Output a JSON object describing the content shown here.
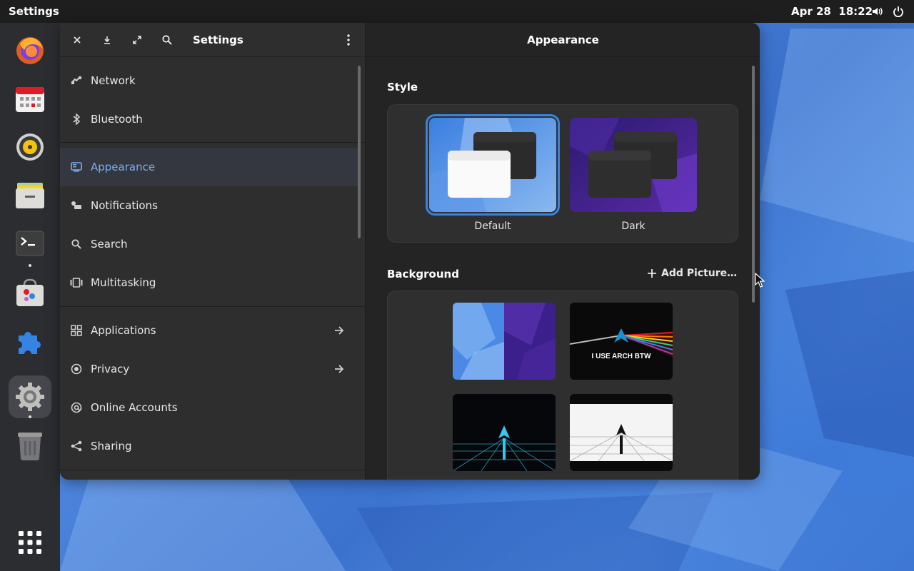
{
  "topbar": {
    "activity": "Settings",
    "date": "Apr 28",
    "time": "18:22",
    "tray_icons": [
      "volume-icon",
      "power-icon"
    ]
  },
  "dock": {
    "items": [
      "firefox",
      "calendar",
      "rhythmbox",
      "files",
      "terminal",
      "software",
      "extensions",
      "settings",
      "trash",
      "app-grid"
    ],
    "active": "settings"
  },
  "window": {
    "sidebar_title": "Settings",
    "content_title": "Appearance",
    "nav": [
      {
        "label": "Network",
        "icon": "network-icon",
        "arrow": false
      },
      {
        "label": "Bluetooth",
        "icon": "bluetooth-icon",
        "arrow": false
      },
      {
        "label": "Appearance",
        "icon": "display-icon",
        "arrow": false,
        "selected": true
      },
      {
        "label": "Notifications",
        "icon": "notification-icon",
        "arrow": false
      },
      {
        "label": "Search",
        "icon": "search-icon",
        "arrow": false
      },
      {
        "label": "Multitasking",
        "icon": "multitasking-icon",
        "arrow": false
      },
      {
        "label": "Applications",
        "icon": "apps-grid-icon",
        "arrow": true
      },
      {
        "label": "Privacy",
        "icon": "privacy-icon",
        "arrow": true
      },
      {
        "label": "Online Accounts",
        "icon": "at-icon",
        "arrow": false
      },
      {
        "label": "Sharing",
        "icon": "share-icon",
        "arrow": false
      }
    ],
    "style": {
      "title": "Style",
      "options": [
        {
          "label": "Default",
          "selected": true
        },
        {
          "label": "Dark",
          "selected": false
        }
      ]
    },
    "background": {
      "title": "Background",
      "add_label": "Add Picture…",
      "thumbs": [
        {
          "name": "blue-purple-split",
          "caption": ""
        },
        {
          "name": "arch-prism",
          "caption": "I USE ARCH BTW"
        },
        {
          "name": "arch-dark-grid",
          "caption": ""
        },
        {
          "name": "arch-light-grid",
          "caption": ""
        }
      ]
    }
  },
  "colors": {
    "accent": "#3584e4",
    "selected_text": "#78aeed",
    "window_bg": "#242424",
    "sidebar_bg": "#2e2e2e"
  }
}
